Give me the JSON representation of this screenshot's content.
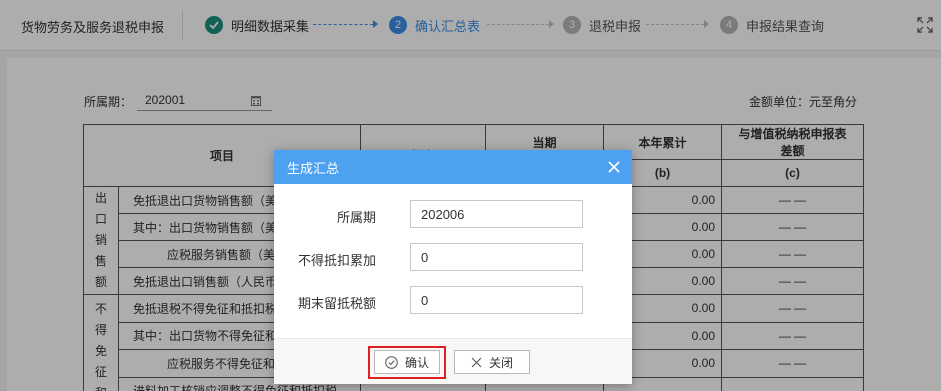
{
  "app": {
    "title": "货物劳务及服务退税申报"
  },
  "steps": [
    {
      "num": "",
      "label": "明细数据采集",
      "state": "done"
    },
    {
      "num": "2",
      "label": "确认汇总表",
      "state": "active"
    },
    {
      "num": "3",
      "label": "退税申报",
      "state": "todo"
    },
    {
      "num": "4",
      "label": "申报结果查询",
      "state": "todo"
    }
  ],
  "filter": {
    "period_label": "所属期：",
    "period_value": "202001",
    "unit_label": "金额单位：元至角分"
  },
  "table": {
    "headers": {
      "item": "项目",
      "col2": "栏次",
      "col3": "当期",
      "col4": "本年累计",
      "col4_sub": "(b)",
      "col5_line1": "与增值税纳税申报表",
      "col5_line2": "差额",
      "col5_sub": "(c)"
    },
    "group1": "出口销售额",
    "group2": "不得免征和",
    "rows": [
      {
        "label": "免抵退出口货物销售额（美",
        "cumulative": "0.00",
        "diff": "— —"
      },
      {
        "label": "其中：出口货物销售额（美",
        "cumulative": "0.00",
        "diff": "— —"
      },
      {
        "label": "应税服务销售额（美",
        "cumulative": "0.00",
        "diff": "— —"
      },
      {
        "label": "免抵退出口销售额（人民币",
        "cumulative": "0.00",
        "diff": "— —"
      },
      {
        "label": "免抵退税不得免征和抵扣税",
        "cumulative": "0.00",
        "diff": "— —"
      },
      {
        "label": "其中：出口货物不得免征和",
        "cumulative": "0.00",
        "diff": "— —"
      },
      {
        "label": "应税服务不得免征和",
        "cumulative": "0.00",
        "diff": "— —"
      },
      {
        "label": "进料加工核销应调整不得免征和抵扣税",
        "cumulative": "",
        "diff": ""
      }
    ]
  },
  "modal": {
    "title": "生成汇总",
    "fields": [
      {
        "label": "所属期",
        "value": "202006"
      },
      {
        "label": "不得抵扣累加",
        "value": "0"
      },
      {
        "label": "期末留抵税额",
        "value": "0"
      }
    ],
    "confirm_label": "确认",
    "close_label": "关闭"
  },
  "colors": {
    "accent": "#4da1f0",
    "step_done": "#1c8f7e",
    "step_active": "#3a8ee6",
    "highlight": "#e02020"
  }
}
